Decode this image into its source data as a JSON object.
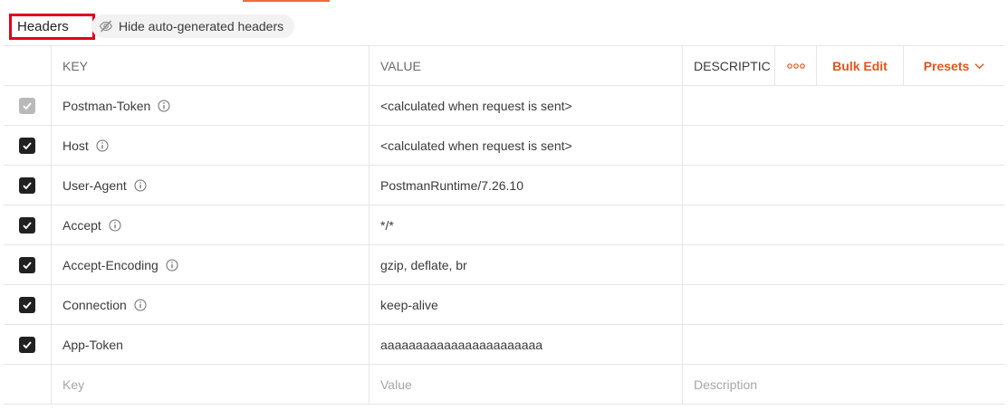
{
  "toolbar": {
    "headers_label": "Headers",
    "hide_auto_label": "Hide auto-generated headers"
  },
  "table": {
    "columns": {
      "key": "KEY",
      "value": "VALUE",
      "description": "DESCRIPTIC",
      "bulk_edit": "Bulk Edit",
      "presets": "Presets"
    },
    "rows": [
      {
        "key": "Postman-Token",
        "value": "<calculated when request is sent>",
        "checked": true,
        "disabled": true,
        "info": true
      },
      {
        "key": "Host",
        "value": "<calculated when request is sent>",
        "checked": true,
        "disabled": false,
        "info": true
      },
      {
        "key": "User-Agent",
        "value": "PostmanRuntime/7.26.10",
        "checked": true,
        "disabled": false,
        "info": true
      },
      {
        "key": "Accept",
        "value": "*/*",
        "checked": true,
        "disabled": false,
        "info": true
      },
      {
        "key": "Accept-Encoding",
        "value": "gzip, deflate, br",
        "checked": true,
        "disabled": false,
        "info": true
      },
      {
        "key": "Connection",
        "value": "keep-alive",
        "checked": true,
        "disabled": false,
        "info": true
      },
      {
        "key": "App-Token",
        "value": "aaaaaaaaaaaaaaaaaaaaaaa",
        "checked": true,
        "disabled": false,
        "info": false
      }
    ],
    "new_row": {
      "key_placeholder": "Key",
      "value_placeholder": "Value",
      "description_placeholder": "Description"
    }
  },
  "colors": {
    "accent": "#e0561c",
    "highlight_border": "#e0001b"
  }
}
